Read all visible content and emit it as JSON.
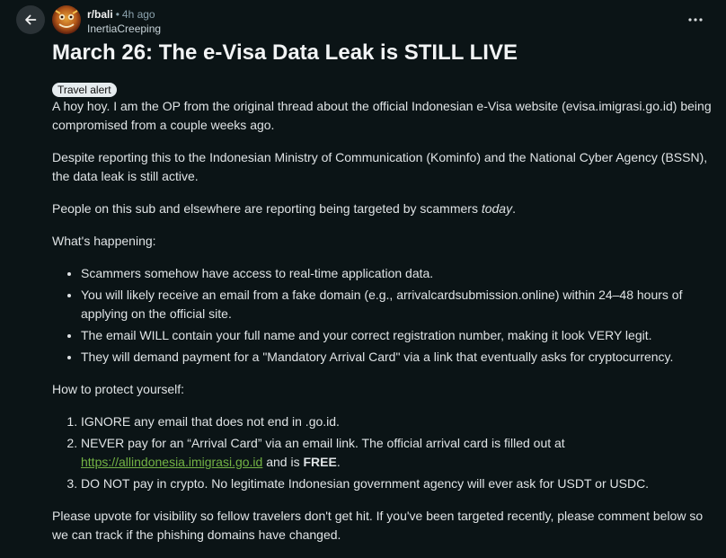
{
  "header": {
    "subreddit": "r/bali",
    "separator": "•",
    "time": "4h ago",
    "username": "InertiaCreeping"
  },
  "icons": {
    "back": "arrow-left-icon",
    "more": "more-horizontal-icon"
  },
  "post": {
    "title": "March 26: The e-Visa Data Leak is STILL LIVE",
    "flair": "Travel alert",
    "p1": "A hoy hoy. I am the OP from the original thread about the official Indonesian e-Visa website (evisa.imigrasi.go.id) being compromised from a couple weeks ago.",
    "p2": "Despite reporting this to the Indonesian Ministry of Communication (Kominfo) and the National Cyber Agency (BSSN), the data leak is still active.",
    "p3_prefix": "People on this sub and elsewhere are reporting being targeted by scammers ",
    "p3_em": "today",
    "p3_suffix": ".",
    "whats_happening": "What's happening:",
    "bullets": [
      "Scammers somehow have access to real-time application data.",
      "You will likely receive an email from a fake domain (e.g., arrivalcardsubmission.online) within 24–48 hours of applying on the official site.",
      "The email WILL contain your full name and your correct registration number, making it look VERY legit.",
      "They will demand payment for a \"Mandatory Arrival Card\" via a link that eventually asks for cryptocurrency."
    ],
    "how_to_protect": "How to protect yourself:",
    "steps": {
      "s1": "IGNORE any email that does not end in .go.id.",
      "s2_prefix": "NEVER pay for an “Arrival Card” via an email link. The official arrival card is filled out at ",
      "s2_link": "https://allindonesia.imigrasi.go.id",
      "s2_mid": " and is ",
      "s2_bold": "FREE",
      "s2_suffix": ".",
      "s3": "DO NOT pay in crypto. No legitimate Indonesian government agency will ever ask for USDT or USDC."
    },
    "closing": "Please upvote for visibility so fellow travelers don't get hit. If you've been targeted recently, please comment below so we can track if the phishing domains have changed."
  },
  "colors": {
    "background": "#0b1416",
    "link": "#73b344",
    "flair_bg": "#e5ebee"
  }
}
